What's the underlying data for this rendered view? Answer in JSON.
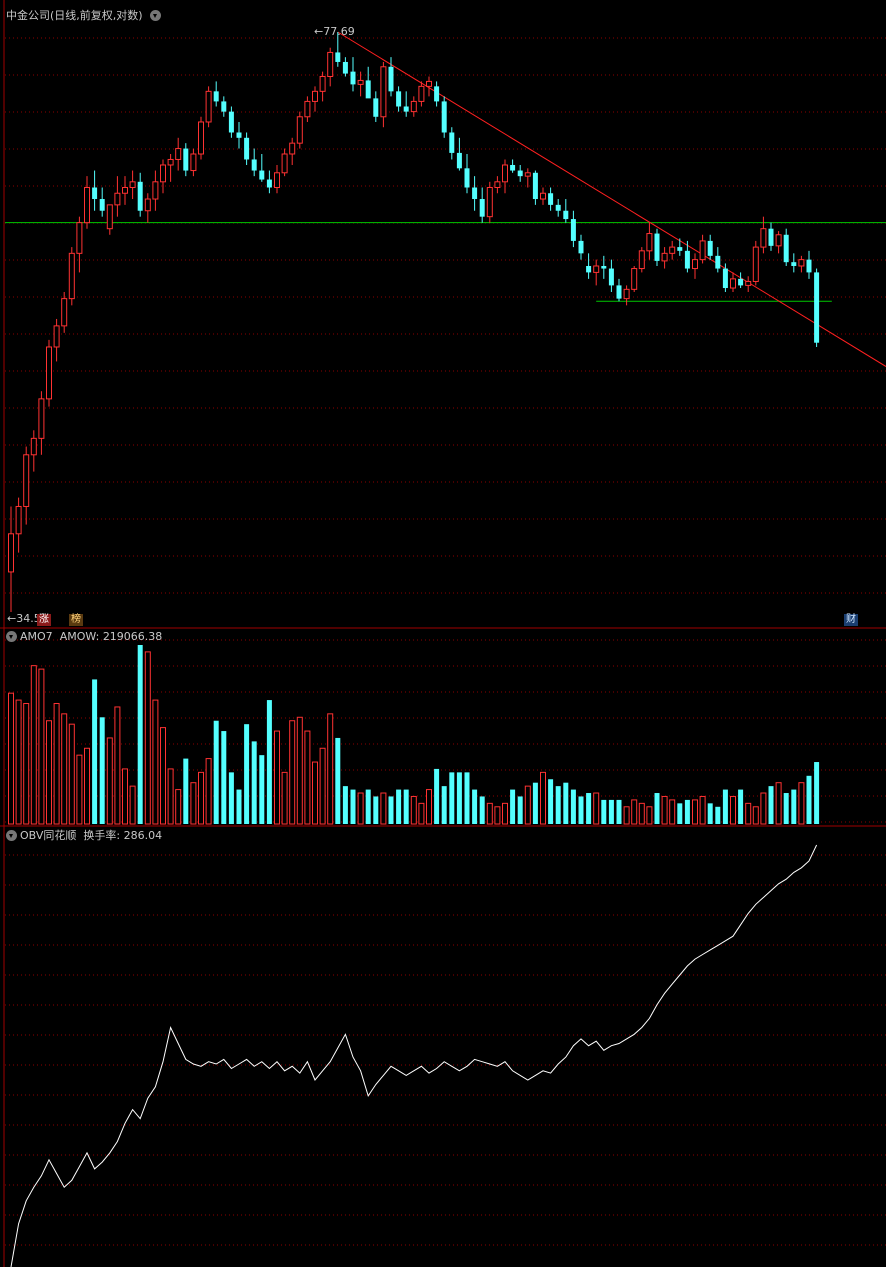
{
  "header": {
    "stock_name": "中金公司",
    "mode": "(日线,前复权,对数)"
  },
  "price_panel": {
    "high_label": "77.69",
    "low_label": "34.51",
    "badges": {
      "zhang": "涨",
      "bang": "榜",
      "cai": "财"
    }
  },
  "volume_panel": {
    "indicator": "AMO7",
    "value_label": "AMOW:",
    "value": "219066.38"
  },
  "obv_panel": {
    "indicator": "OBV同花顺",
    "value_label": "换手率:",
    "value": "286.04"
  },
  "colors": {
    "up": "#ff3232",
    "down": "#54ffff",
    "grid": "#8b0000",
    "panel_border": "#a00000",
    "trendline": "#ff2020",
    "support": "#00c800",
    "obv_line": "#ffffff",
    "text": "#c8c8c8"
  },
  "chart_data": [
    {
      "type": "candlestick",
      "title": "中金公司",
      "scale": "log",
      "ylim": [
        34.51,
        77.69
      ],
      "annotations": [
        "77.69",
        "34.51"
      ],
      "trendline": "descending line drawn from the 77.69 peak",
      "support_levels": [
        59.5,
        53.3
      ],
      "ohlc": [
        [
          36.5,
          40.0,
          34.51,
          38.5
        ],
        [
          38.5,
          40.5,
          37.5,
          40.0
        ],
        [
          40.0,
          43.5,
          39.0,
          43.0
        ],
        [
          43.0,
          44.5,
          42.0,
          44.0
        ],
        [
          44.0,
          47.0,
          43.0,
          46.5
        ],
        [
          46.5,
          50.5,
          46.0,
          50.0
        ],
        [
          50.0,
          52.0,
          49.0,
          51.5
        ],
        [
          51.5,
          54.0,
          51.0,
          53.5
        ],
        [
          53.5,
          57.5,
          53.0,
          57.0
        ],
        [
          57.0,
          60.0,
          55.5,
          59.5
        ],
        [
          59.5,
          63.5,
          59.0,
          62.5
        ],
        [
          62.5,
          64.0,
          60.5,
          61.5
        ],
        [
          61.5,
          62.5,
          60.0,
          60.5
        ],
        [
          59.0,
          60.5,
          58.5,
          61.0
        ],
        [
          61.0,
          63.5,
          60.0,
          62.0
        ],
        [
          62.0,
          63.5,
          61.0,
          62.5
        ],
        [
          62.5,
          64.0,
          61.5,
          63.0
        ],
        [
          63.0,
          63.8,
          60.0,
          60.5
        ],
        [
          60.5,
          62.0,
          59.5,
          61.5
        ],
        [
          61.5,
          64.0,
          60.5,
          63.0
        ],
        [
          63.0,
          65.0,
          62.0,
          64.5
        ],
        [
          64.5,
          65.5,
          63.0,
          65.0
        ],
        [
          65.0,
          67.0,
          64.0,
          66.0
        ],
        [
          66.0,
          66.5,
          63.5,
          64.0
        ],
        [
          64.0,
          66.0,
          63.5,
          65.5
        ],
        [
          65.5,
          69.0,
          65.0,
          68.5
        ],
        [
          68.5,
          72.0,
          68.0,
          71.5
        ],
        [
          71.5,
          72.5,
          70.0,
          70.5
        ],
        [
          70.5,
          71.0,
          69.0,
          69.5
        ],
        [
          69.5,
          70.0,
          67.0,
          67.5
        ],
        [
          67.5,
          68.5,
          66.0,
          67.0
        ],
        [
          67.0,
          67.5,
          64.5,
          65.0
        ],
        [
          65.0,
          66.0,
          63.5,
          64.0
        ],
        [
          64.0,
          65.5,
          63.0,
          63.2
        ],
        [
          63.2,
          64.0,
          62.0,
          62.5
        ],
        [
          62.5,
          64.5,
          62.0,
          63.8
        ],
        [
          63.8,
          66.0,
          63.5,
          65.5
        ],
        [
          65.5,
          67.0,
          64.5,
          66.5
        ],
        [
          66.5,
          69.5,
          66.0,
          69.0
        ],
        [
          69.0,
          71.0,
          68.5,
          70.5
        ],
        [
          70.5,
          72.0,
          69.5,
          71.5
        ],
        [
          71.5,
          73.5,
          70.5,
          73.0
        ],
        [
          73.0,
          76.0,
          72.0,
          75.5
        ],
        [
          75.5,
          77.69,
          74.0,
          74.5
        ],
        [
          74.5,
          75.0,
          73.0,
          73.3
        ],
        [
          73.5,
          75.0,
          71.5,
          72.2
        ],
        [
          72.2,
          73.5,
          71.0,
          72.6
        ],
        [
          72.6,
          74.0,
          71.5,
          70.8
        ],
        [
          70.8,
          71.5,
          68.5,
          69.0
        ],
        [
          69.0,
          74.5,
          68.0,
          74.0
        ],
        [
          74.0,
          75.0,
          71.0,
          71.5
        ],
        [
          71.5,
          72.0,
          69.5,
          70.0
        ],
        [
          70.0,
          71.5,
          69.0,
          69.5
        ],
        [
          69.5,
          71.0,
          69.0,
          70.5
        ],
        [
          70.5,
          72.5,
          70.0,
          72.0
        ],
        [
          72.0,
          73.0,
          71.0,
          72.5
        ],
        [
          72.0,
          72.5,
          70.0,
          70.5
        ],
        [
          70.5,
          71.0,
          67.0,
          67.5
        ],
        [
          67.5,
          68.0,
          65.0,
          65.6
        ],
        [
          65.6,
          67.0,
          64.0,
          64.2
        ],
        [
          64.2,
          65.5,
          62.0,
          62.5
        ],
        [
          62.5,
          63.5,
          60.5,
          61.5
        ],
        [
          61.5,
          62.5,
          59.5,
          60.0
        ],
        [
          60.0,
          63.0,
          59.5,
          62.5
        ],
        [
          62.5,
          63.5,
          62.0,
          63.0
        ],
        [
          63.0,
          65.0,
          62.0,
          64.5
        ],
        [
          64.5,
          65.0,
          63.8,
          64.0
        ],
        [
          64.0,
          64.5,
          63.0,
          63.5
        ],
        [
          63.5,
          64.2,
          62.5,
          63.8
        ],
        [
          63.8,
          64.0,
          61.0,
          61.5
        ],
        [
          61.5,
          62.5,
          61.0,
          62.0
        ],
        [
          62.0,
          62.5,
          60.5,
          61.0
        ],
        [
          61.0,
          61.5,
          60.0,
          60.5
        ],
        [
          60.5,
          61.5,
          59.5,
          59.8
        ],
        [
          59.8,
          60.5,
          57.5,
          58.0
        ],
        [
          58.0,
          58.5,
          56.5,
          57.0
        ],
        [
          56.0,
          57.0,
          55.0,
          55.5
        ],
        [
          55.5,
          56.5,
          54.5,
          56.0
        ],
        [
          56.0,
          56.8,
          55.0,
          55.8
        ],
        [
          55.8,
          56.5,
          54.0,
          54.5
        ],
        [
          54.5,
          55.0,
          53.3,
          53.5
        ],
        [
          53.5,
          54.5,
          53.0,
          54.2
        ],
        [
          54.2,
          56.0,
          54.0,
          55.8
        ],
        [
          55.8,
          57.5,
          55.5,
          57.2
        ],
        [
          57.2,
          59.5,
          56.5,
          58.6
        ],
        [
          58.6,
          59.0,
          56.0,
          56.4
        ],
        [
          56.4,
          57.5,
          55.8,
          57.0
        ],
        [
          57.0,
          58.0,
          56.5,
          57.5
        ],
        [
          57.5,
          58.2,
          56.8,
          57.2
        ],
        [
          57.2,
          58.0,
          55.5,
          55.8
        ],
        [
          55.8,
          57.0,
          55.0,
          56.5
        ],
        [
          56.5,
          58.5,
          56.2,
          58.0
        ],
        [
          58.0,
          58.5,
          56.5,
          56.8
        ],
        [
          56.8,
          57.5,
          55.5,
          55.8
        ],
        [
          55.8,
          56.2,
          54.0,
          54.3
        ],
        [
          54.3,
          55.5,
          54.0,
          55.0
        ],
        [
          55.0,
          55.5,
          54.3,
          54.5
        ],
        [
          54.5,
          55.2,
          54.0,
          54.8
        ],
        [
          54.8,
          58.0,
          54.5,
          57.5
        ],
        [
          57.5,
          60.0,
          57.0,
          59.0
        ],
        [
          59.0,
          59.5,
          57.2,
          57.6
        ],
        [
          57.6,
          58.8,
          57.0,
          58.5
        ],
        [
          58.5,
          59.0,
          56.0,
          56.3
        ],
        [
          56.3,
          57.0,
          55.5,
          56.0
        ],
        [
          56.0,
          56.8,
          55.5,
          56.5
        ],
        [
          56.5,
          57.2,
          55.0,
          55.5
        ],
        [
          55.5,
          55.8,
          50.0,
          50.3
        ]
      ]
    },
    {
      "type": "bar",
      "title": "AMO7",
      "values": [
        76,
        72,
        70,
        92,
        90,
        60,
        70,
        64,
        58,
        40,
        44,
        84,
        62,
        50,
        68,
        32,
        22,
        104,
        100,
        72,
        56,
        32,
        20,
        38,
        24,
        30,
        38,
        60,
        54,
        30,
        20,
        58,
        48,
        40,
        72,
        54,
        30,
        60,
        62,
        54,
        36,
        44,
        64,
        50,
        22,
        20,
        18,
        20,
        16,
        18,
        16,
        20,
        20,
        16,
        12,
        20,
        32,
        22,
        30,
        30,
        30,
        20,
        16,
        12,
        10,
        12,
        20,
        16,
        22,
        24,
        30,
        26,
        22,
        24,
        20,
        16,
        18,
        18,
        14,
        14,
        14,
        10,
        14,
        12,
        10,
        18,
        16,
        14,
        12,
        14,
        14,
        16,
        12,
        10,
        20,
        16,
        20,
        12,
        10,
        18,
        22,
        24,
        18,
        20,
        24,
        28,
        36
      ]
    },
    {
      "type": "line",
      "title": "OBV同花顺",
      "values": [
        0,
        38,
        58,
        70,
        80,
        94,
        82,
        70,
        76,
        88,
        100,
        86,
        92,
        100,
        110,
        126,
        138,
        130,
        148,
        158,
        180,
        210,
        196,
        182,
        178,
        176,
        180,
        178,
        182,
        174,
        178,
        182,
        176,
        180,
        174,
        180,
        172,
        176,
        170,
        180,
        164,
        172,
        180,
        192,
        204,
        184,
        172,
        150,
        160,
        168,
        176,
        172,
        168,
        172,
        176,
        170,
        174,
        180,
        176,
        172,
        176,
        182,
        180,
        178,
        176,
        180,
        172,
        168,
        164,
        168,
        172,
        170,
        178,
        184,
        194,
        200,
        194,
        198,
        190,
        194,
        196,
        200,
        204,
        210,
        218,
        230,
        240,
        248,
        256,
        264,
        270,
        274,
        278,
        282,
        286,
        290,
        300,
        310,
        318,
        324,
        330,
        336,
        340,
        346,
        350,
        356,
        370
      ]
    }
  ]
}
